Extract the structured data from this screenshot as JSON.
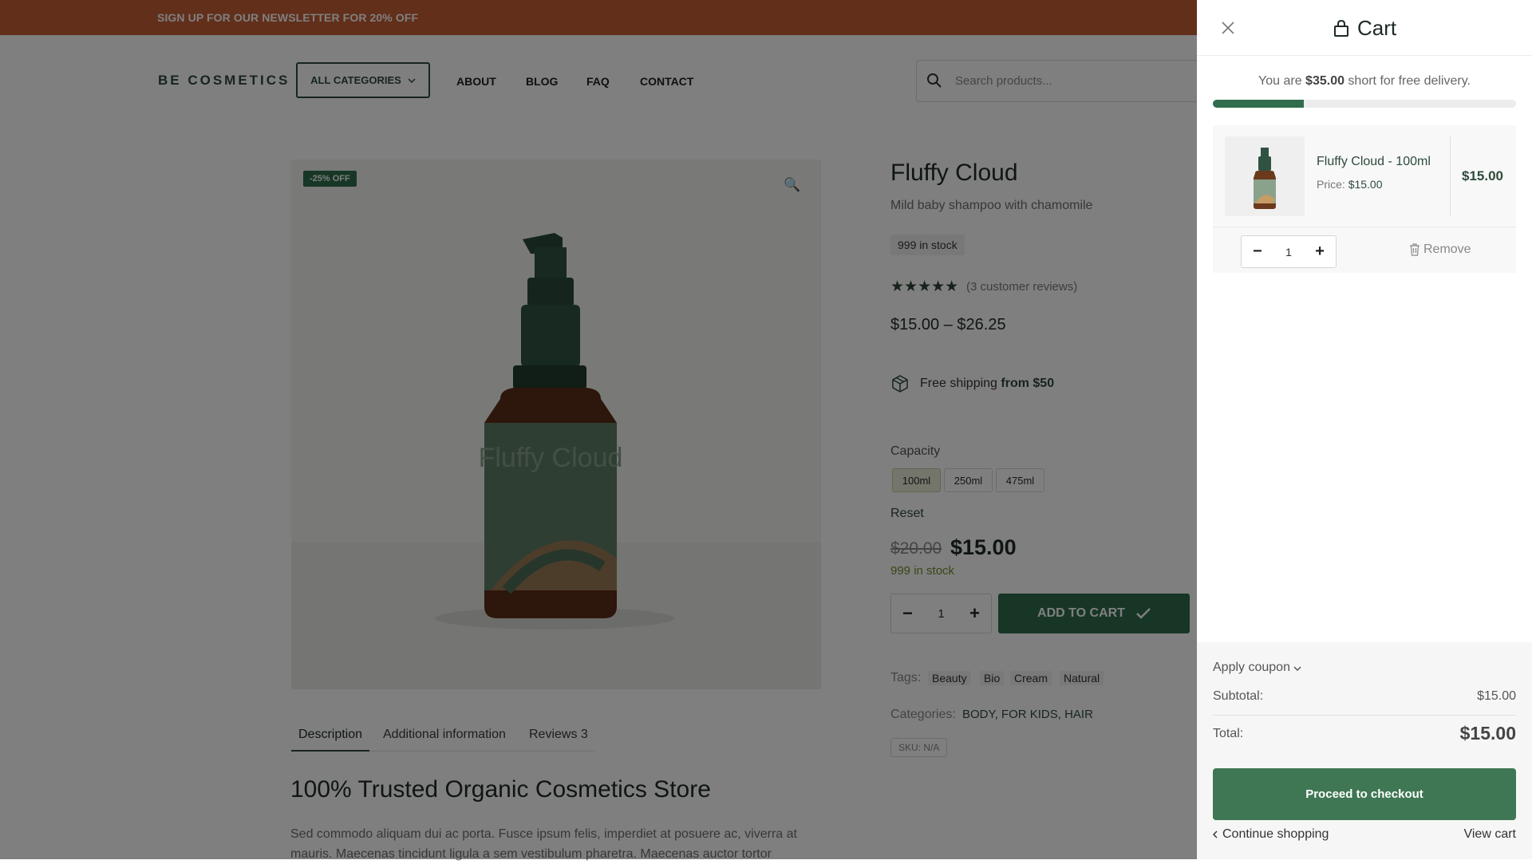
{
  "banner": {
    "text": "SIGN UP FOR OUR NEWSLETTER FOR 20% OFF"
  },
  "header": {
    "logo": "BE COSMETICS",
    "all_categories": "ALL CATEGORIES",
    "nav": [
      "ABOUT",
      "BLOG",
      "FAQ",
      "CONTACT"
    ],
    "search_placeholder": "Search products..."
  },
  "product": {
    "sale_badge": "-25% OFF",
    "label_text": "Fluffy Cloud",
    "title": "Fluffy Cloud",
    "subtitle": "Mild baby shampoo with chamomile",
    "stock_badge": "999 in stock",
    "rating_stars": "★★★★★",
    "rating_value": 5,
    "reviews_link": "(3 customer reviews)",
    "price_range": "$15.00 – $26.25",
    "shipping_text": "Free shipping ",
    "shipping_bold": "from $50",
    "capacity_label": "Capacity",
    "capacity_options": [
      "100ml",
      "250ml",
      "475ml"
    ],
    "capacity_selected": "100ml",
    "reset": "Reset",
    "old_price": "$20.00",
    "new_price": "$15.00",
    "stock_text": "999 in stock",
    "qty": "1",
    "add_to_cart": "ADD TO CART",
    "tags_label": "Tags:",
    "tags": [
      "Beauty",
      "Bio",
      "Cream",
      "Natural"
    ],
    "categories_label": "Categories:",
    "categories": "BODY, FOR KIDS, HAIR",
    "sku": "SKU: N/A",
    "tabs": [
      "Description",
      "Additional information",
      "Reviews 3"
    ],
    "section_title": "100% Trusted Organic Cosmetics Store",
    "section_body": "Sed commodo aliquam dui ac porta. Fusce ipsum felis, imperdiet at posuere ac, viverra at mauris. Maecenas tincidunt ligula a sem vestibulum pharetra. Maecenas auctor tortor"
  },
  "cart": {
    "title": "Cart",
    "free_prefix": "You are ",
    "free_amount": "$35.00",
    "free_suffix": " short for free delivery.",
    "progress": 0.3,
    "item": {
      "name": "Fluffy Cloud - 100ml",
      "price_label": "Price: ",
      "price": "$15.00",
      "total": "$15.00",
      "qty": "1",
      "remove": "Remove"
    },
    "coupon": "Apply coupon",
    "subtotal_label": "Subtotal:",
    "subtotal": "$15.00",
    "total_label": "Total:",
    "total": "$15.00",
    "checkout": "Proceed to checkout",
    "continue": "Continue shopping",
    "view_cart": "View cart"
  },
  "colors": {
    "banner": "#c55e34",
    "brand_green": "#2f6d4c",
    "checkout_green": "#3f7754",
    "overlay": "rgba(0,0,0,0.5)"
  }
}
